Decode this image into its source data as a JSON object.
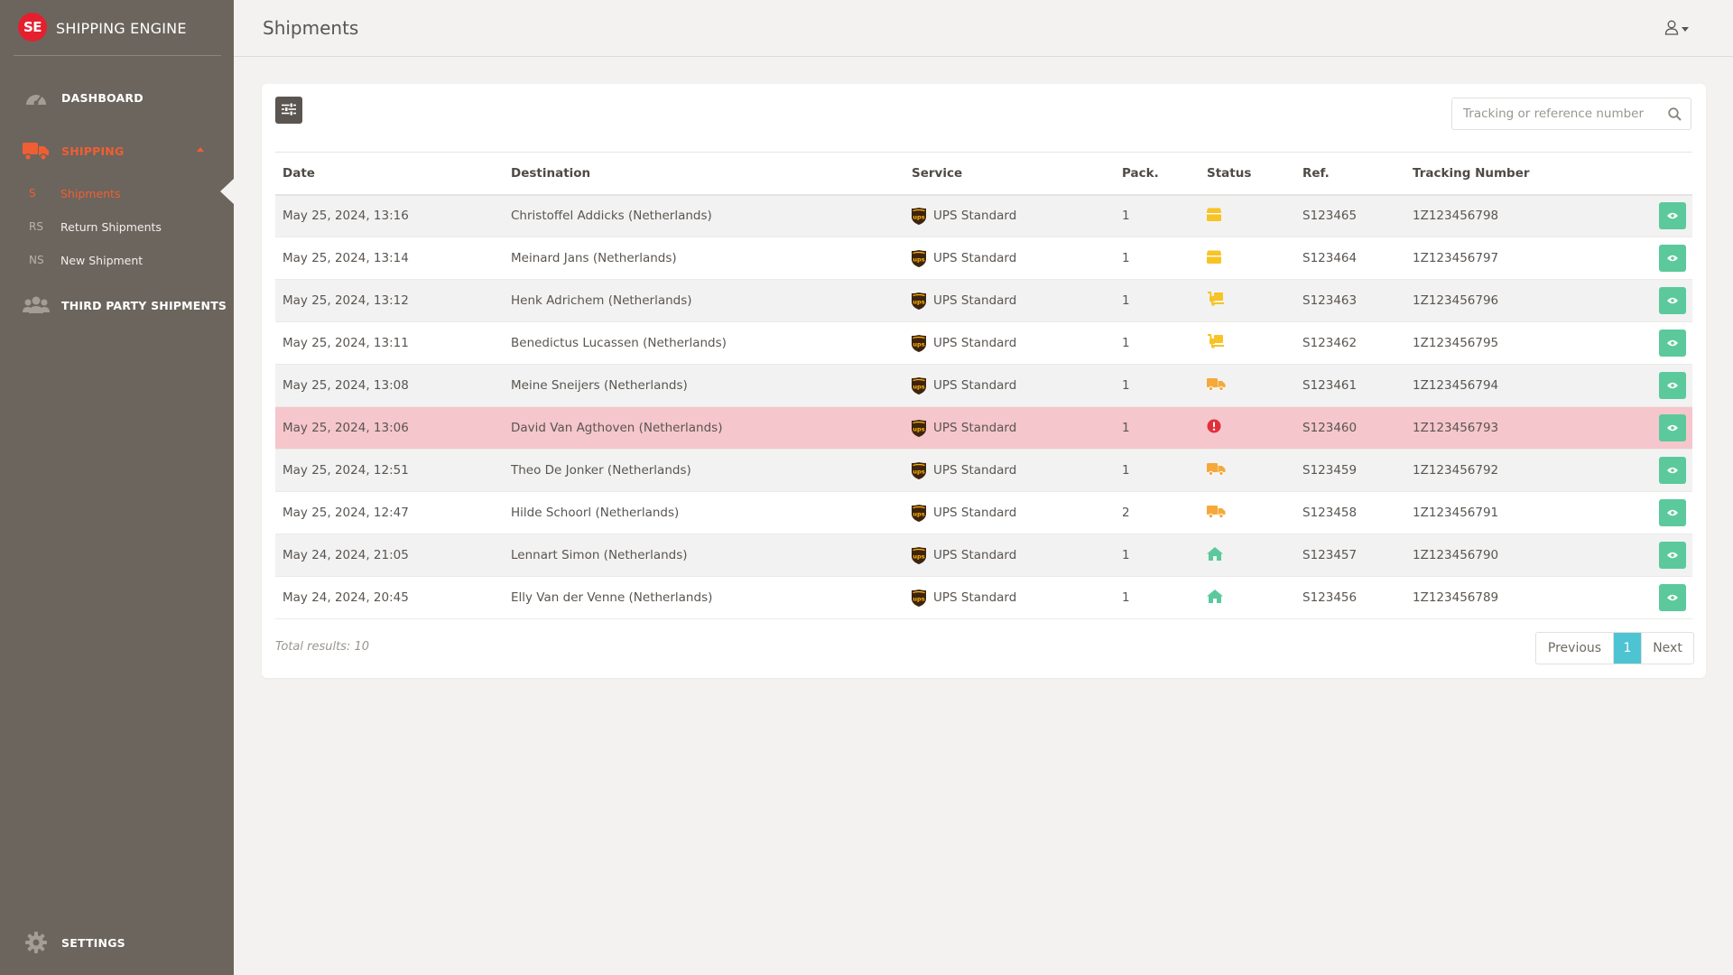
{
  "brand": {
    "logo": "SE",
    "name": "SHIPPING ENGINE"
  },
  "nav": {
    "dashboard": "DASHBOARD",
    "shipping": "SHIPPING",
    "third_party": "THIRD PARTY SHIPMENTS",
    "settings": "SETTINGS",
    "sub": [
      {
        "abbr": "S",
        "label": "Shipments"
      },
      {
        "abbr": "RS",
        "label": "Return Shipments"
      },
      {
        "abbr": "NS",
        "label": "New Shipment"
      }
    ]
  },
  "header": {
    "title": "Shipments"
  },
  "search": {
    "placeholder": "Tracking or reference number",
    "value": ""
  },
  "table": {
    "columns": [
      "Date",
      "Destination",
      "Service",
      "Pack.",
      "Status",
      "Ref.",
      "Tracking Number"
    ],
    "rows": [
      {
        "date": "May 25, 2024, 13:16",
        "destination": "Christoffel Addicks (Netherlands)",
        "service": "UPS Standard",
        "pack": "1",
        "status": "package-icon",
        "ref": "S123465",
        "tracking": "1Z123456798"
      },
      {
        "date": "May 25, 2024, 13:14",
        "destination": "Meinard Jans (Netherlands)",
        "service": "UPS Standard",
        "pack": "1",
        "status": "package-icon",
        "ref": "S123464",
        "tracking": "1Z123456797"
      },
      {
        "date": "May 25, 2024, 13:12",
        "destination": "Henk Adrichem (Netherlands)",
        "service": "UPS Standard",
        "pack": "1",
        "status": "dolly-icon",
        "ref": "S123463",
        "tracking": "1Z123456796"
      },
      {
        "date": "May 25, 2024, 13:11",
        "destination": "Benedictus Lucassen (Netherlands)",
        "service": "UPS Standard",
        "pack": "1",
        "status": "dolly-icon",
        "ref": "S123462",
        "tracking": "1Z123456795"
      },
      {
        "date": "May 25, 2024, 13:08",
        "destination": "Meine Sneijers (Netherlands)",
        "service": "UPS Standard",
        "pack": "1",
        "status": "truck-icon",
        "ref": "S123461",
        "tracking": "1Z123456794"
      },
      {
        "date": "May 25, 2024, 13:06",
        "destination": "David Van Agthoven (Netherlands)",
        "service": "UPS Standard",
        "pack": "1",
        "status": "error-icon",
        "ref": "S123460",
        "tracking": "1Z123456793"
      },
      {
        "date": "May 25, 2024, 12:51",
        "destination": "Theo De Jonker (Netherlands)",
        "service": "UPS Standard",
        "pack": "1",
        "status": "truck-icon",
        "ref": "S123459",
        "tracking": "1Z123456792"
      },
      {
        "date": "May 25, 2024, 12:47",
        "destination": "Hilde Schoorl (Netherlands)",
        "service": "UPS Standard",
        "pack": "2",
        "status": "truck-icon",
        "ref": "S123458",
        "tracking": "1Z123456791"
      },
      {
        "date": "May 24, 2024, 21:05",
        "destination": "Lennart Simon (Netherlands)",
        "service": "UPS Standard",
        "pack": "1",
        "status": "home-icon",
        "ref": "S123457",
        "tracking": "1Z123456790"
      },
      {
        "date": "May 24, 2024, 20:45",
        "destination": "Elly Van der Venne (Netherlands)",
        "service": "UPS Standard",
        "pack": "1",
        "status": "home-icon",
        "ref": "S123456",
        "tracking": "1Z123456789"
      }
    ]
  },
  "footer": {
    "total": "Total results: 10"
  },
  "pagination": {
    "previous": "Previous",
    "current": "1",
    "next": "Next"
  },
  "colors": {
    "sidebar_bg": "#6c655d",
    "accent": "#f05e33",
    "status_package": "#f7c325",
    "status_truck": "#f5a93a",
    "status_error": "#e2303a",
    "status_home": "#5bc99b",
    "view_button": "#5bc99b",
    "error_row": "#f5c6cb",
    "page_active": "#4ec4d3"
  }
}
